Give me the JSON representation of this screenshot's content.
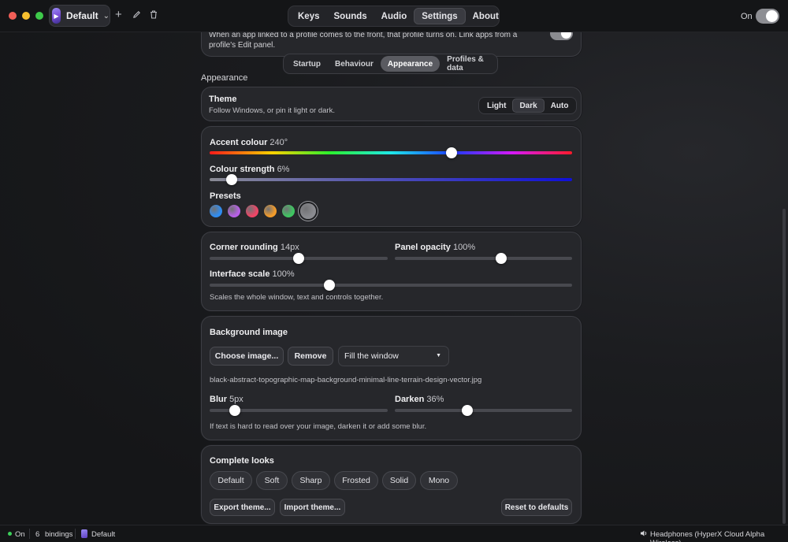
{
  "topbar": {
    "profile_name": "Default",
    "nav_tabs": [
      "Keys",
      "Sounds",
      "Audio",
      "Settings",
      "About"
    ],
    "active_tab": "Settings",
    "power_label": "On",
    "icons": [
      "plus-icon",
      "pencil-icon",
      "trash-icon",
      "chevron-down-icon"
    ]
  },
  "top_card": {
    "text": "When an app linked to a profile comes to the front, that profile turns on. Link apps from a profile's Edit panel."
  },
  "subtabs": [
    "Startup",
    "Behaviour",
    "Appearance",
    "Profiles & data"
  ],
  "active_subtab": "Appearance",
  "section_title": "Appearance",
  "theme": {
    "title": "Theme",
    "desc": "Follow Windows, or pin it light or dark.",
    "options": [
      "Light",
      "Dark",
      "Auto"
    ],
    "selected": "Dark"
  },
  "accent": {
    "label": "Accent colour",
    "value": "240°",
    "hue_fraction": 0.667,
    "strength_label": "Colour strength",
    "strength_value": "6%",
    "strength_fraction": 0.06,
    "presets_label": "Presets",
    "presets": [
      "#2f8cf0",
      "#b760e6",
      "#ee4566",
      "#f29b2a",
      "#3fc561",
      "#8a8b90"
    ],
    "selected_preset": 5
  },
  "layout": {
    "corner_label": "Corner rounding",
    "corner_value": "14px",
    "corner_fraction": 0.5,
    "opacity_label": "Panel opacity",
    "opacity_value": "100%",
    "opacity_fraction": 0.6,
    "scale_label": "Interface scale",
    "scale_value": "100%",
    "scale_fraction": 0.33,
    "scale_desc": "Scales the whole window, text and controls together."
  },
  "background": {
    "title": "Background image",
    "choose": "Choose image...",
    "remove": "Remove",
    "fit_mode": "Fill the window",
    "filename": "black-abstract-topographic-map-background-minimal-line-terrain-design-vector.jpg",
    "blur_label": "Blur",
    "blur_value": "5px",
    "blur_fraction": 0.14,
    "darken_label": "Darken",
    "darken_value": "36%",
    "darken_fraction": 0.41,
    "hint": "If text is hard to read over your image, darken it or add some blur."
  },
  "looks": {
    "title": "Complete looks",
    "presets": [
      "Default",
      "Soft",
      "Sharp",
      "Frosted",
      "Solid",
      "Mono"
    ],
    "export": "Export theme...",
    "import": "Import theme...",
    "reset": "Reset to defaults"
  },
  "statusbar": {
    "state": "On",
    "bindings_count": "6",
    "bindings_label": "bindings",
    "profile": "Default",
    "device": "Headphones (HyperX Cloud Alpha Wireless)"
  },
  "colors": {
    "accent_blue": "#1010d8",
    "status_green": "#3ccf5a"
  }
}
